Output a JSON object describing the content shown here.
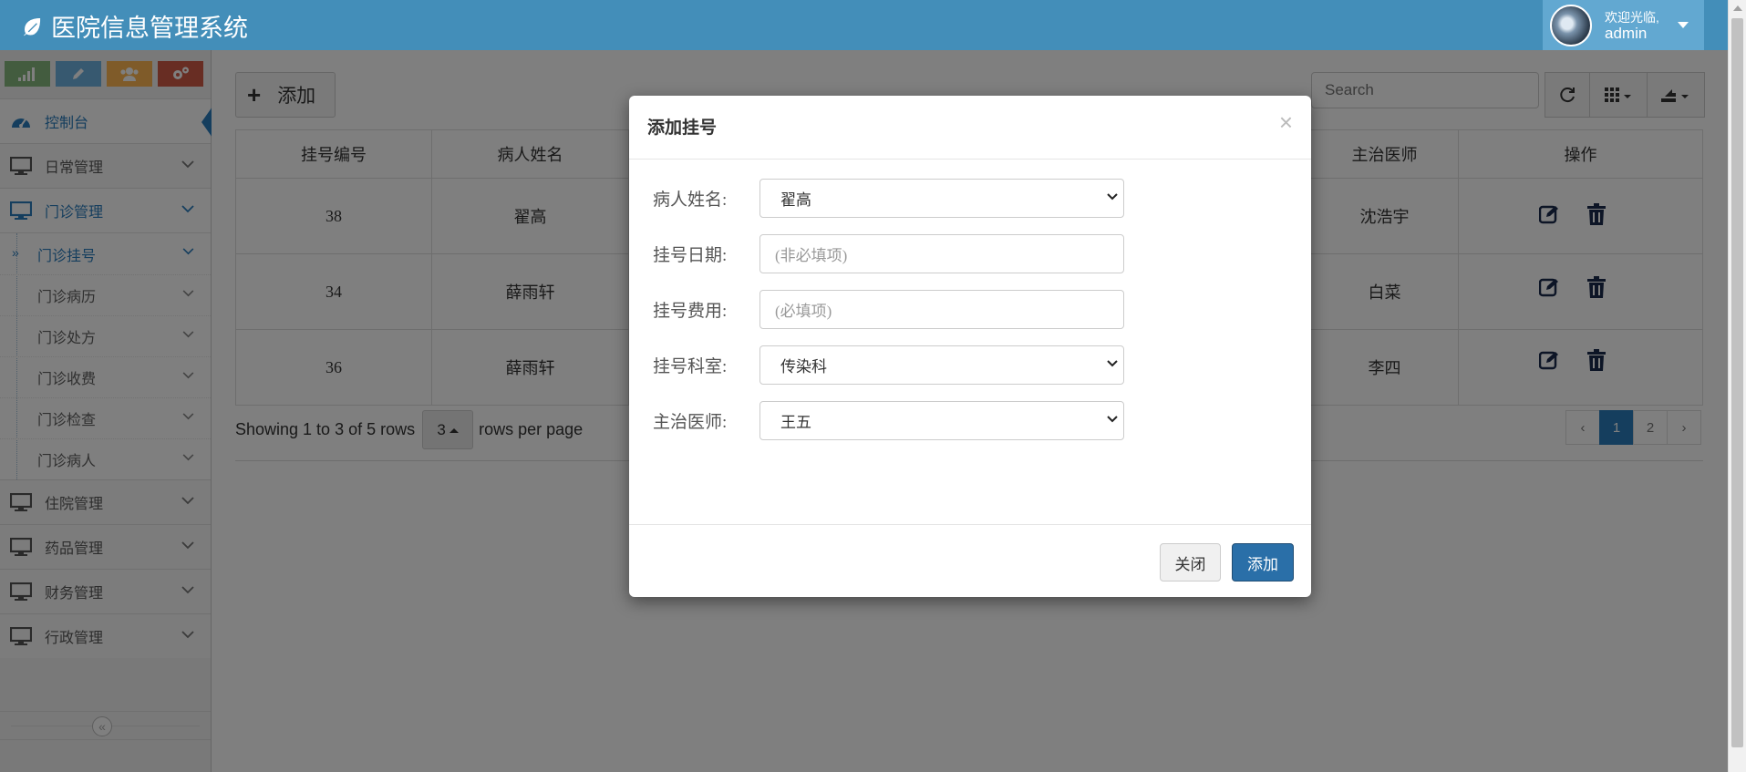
{
  "app": {
    "title": "医院信息管理系统"
  },
  "user": {
    "welcome": "欢迎光临,",
    "name": "admin"
  },
  "sidebar": {
    "shortcut_colors": [
      "#87b87f",
      "#6fb3e0",
      "#ffb752",
      "#d15b47"
    ],
    "items": [
      {
        "label": "控制台",
        "icon": "tachometer-icon"
      },
      {
        "label": "日常管理",
        "icon": "desktop-icon"
      },
      {
        "label": "门诊管理",
        "icon": "desktop-icon"
      },
      {
        "label": "住院管理",
        "icon": "desktop-icon"
      },
      {
        "label": "药品管理",
        "icon": "desktop-icon"
      },
      {
        "label": "财务管理",
        "icon": "desktop-icon"
      },
      {
        "label": "行政管理",
        "icon": "desktop-icon"
      }
    ],
    "submenu": [
      {
        "label": "门诊挂号"
      },
      {
        "label": "门诊病历"
      },
      {
        "label": "门诊处方"
      },
      {
        "label": "门诊收费"
      },
      {
        "label": "门诊检查"
      },
      {
        "label": "门诊病人"
      }
    ]
  },
  "toolbar": {
    "add_label": "添加",
    "search_placeholder": "Search"
  },
  "table": {
    "headers": [
      "挂号编号",
      "病人姓名",
      "主治医师",
      "操作"
    ],
    "rows": [
      {
        "id": "38",
        "patient": "翟高",
        "doctor": "沈浩宇"
      },
      {
        "id": "34",
        "patient": "薛雨轩",
        "doctor": "白菜"
      },
      {
        "id": "36",
        "patient": "薛雨轩",
        "doctor": "李四"
      }
    ]
  },
  "pagination": {
    "showing": "Showing 1 to 3 of 5 rows",
    "page_size": "3",
    "per_page": "rows per page",
    "prev": "‹",
    "next": "›",
    "pages": [
      "1",
      "2"
    ],
    "current_page": "1"
  },
  "modal": {
    "title": "添加挂号",
    "close_x": "×",
    "fields": {
      "patient": {
        "label": "病人姓名:",
        "value": "翟高"
      },
      "date": {
        "label": "挂号日期:",
        "placeholder": "(非必填项)"
      },
      "fee": {
        "label": "挂号费用:",
        "placeholder": "(必填项)"
      },
      "dept": {
        "label": "挂号科室:",
        "value": "传染科"
      },
      "doctor": {
        "label": "主治医师:",
        "value": "王五"
      }
    },
    "close_button": "关闭",
    "add_button": "添加"
  },
  "colors": {
    "navbar": "#438eb9",
    "user_area": "#62a8d1",
    "accent": "#2b7dbc",
    "primary_button": "#2a6fa8"
  }
}
